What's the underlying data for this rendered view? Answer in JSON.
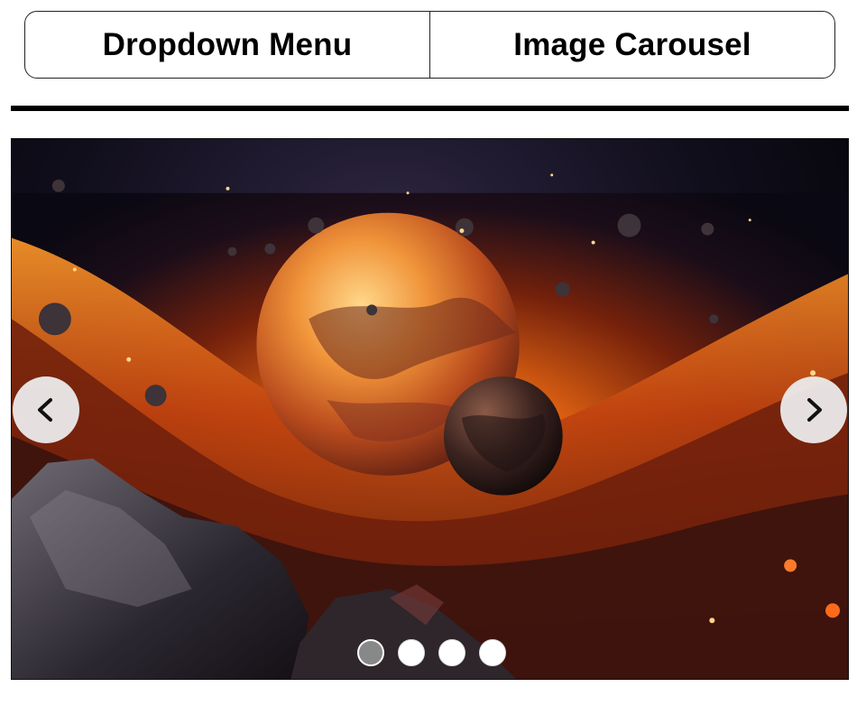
{
  "tabs": [
    {
      "label": "Dropdown Menu"
    },
    {
      "label": "Image Carousel"
    }
  ],
  "carousel": {
    "image_subject": "space scene with fiery planets and asteroids",
    "prev_icon": "chevron-left-icon",
    "next_icon": "chevron-right-icon",
    "slide_count": 4,
    "active_index": 0,
    "colors": {
      "active_dot": "#888888",
      "inactive_dot": "#ffffff",
      "arrow_bg": "#ebebeb"
    }
  }
}
